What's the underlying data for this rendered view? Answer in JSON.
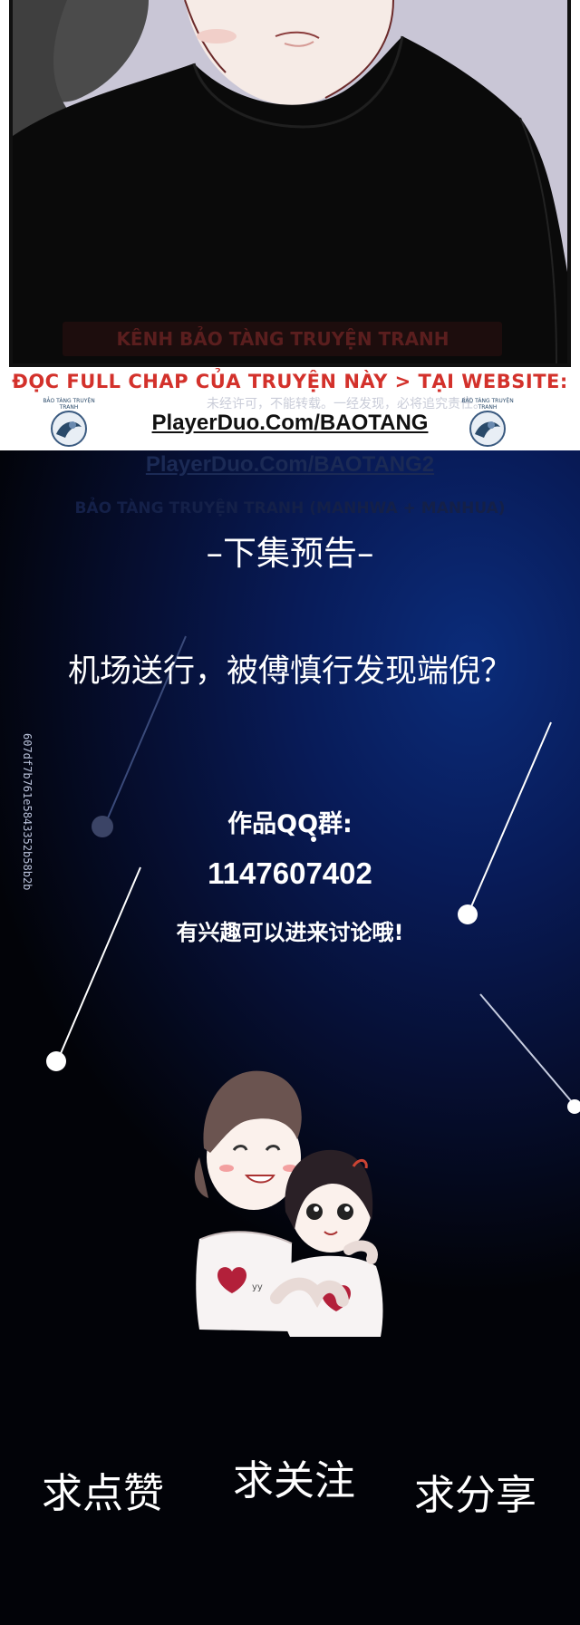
{
  "watermark": {
    "line1": "ĐỌC FULL CHAP CỦA TRUYỆN NÀY > TẠI WEBSITE:",
    "line2": "PlayerDuo.Com/BAOTANG",
    "faint_notice": "未经许可，不能转载。一经发现，必将追究责任。",
    "logo_caption": "BẢO TÀNG TRUYỆN TRANH",
    "ghost_banner": "KÊNH BẢO TÀNG TRUYỆN TRANH",
    "ghost_url": "PlayerDuo.Com/BAOTANG2",
    "ghost_subtitle": "BẢO TÀNG TRUYỆN TRANH (MANHWA + MANHUA)"
  },
  "preview": {
    "title": "–下集预告–",
    "question": "机场送行，被傅慎行发现端倪？",
    "qq_label": "作品QQ群:",
    "qq_number": "1147607402",
    "invite": "有兴趣可以进来讨论哦!",
    "hash_code": "607df7b761e5843352b58b2b"
  },
  "actions": {
    "like": "求点赞",
    "follow": "求关注",
    "share": "求分享"
  },
  "icons": [
    "comic-panel-illustration",
    "museum-logo-icon",
    "couple-illustration",
    "constellation-decoration"
  ],
  "colors": {
    "watermark_red": "#d3312b",
    "dark_background": "#081b58",
    "panel_background": "#c9c6d6"
  }
}
